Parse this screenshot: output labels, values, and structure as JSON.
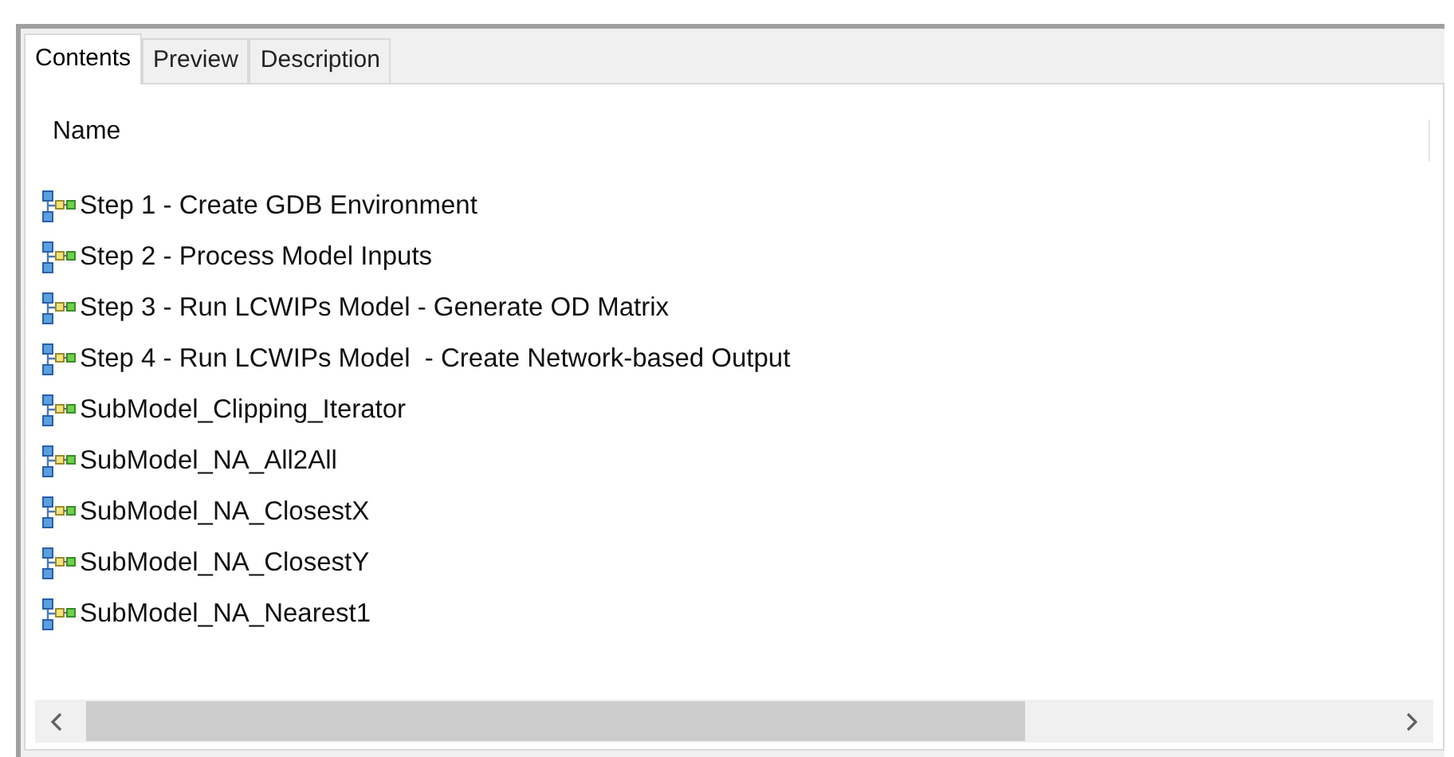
{
  "tabs": [
    {
      "label": "Contents",
      "selected": true
    },
    {
      "label": "Preview",
      "selected": false
    },
    {
      "label": "Description",
      "selected": false
    }
  ],
  "list": {
    "column_header": "Name",
    "items": [
      {
        "label": "Step 1 - Create GDB Environment"
      },
      {
        "label": "Step 2 - Process Model Inputs"
      },
      {
        "label": "Step 3 - Run LCWIPs Model - Generate OD Matrix"
      },
      {
        "label": "Step 4 - Run LCWIPs Model  - Create Network-based Output"
      },
      {
        "label": "SubModel_Clipping_Iterator"
      },
      {
        "label": "SubModel_NA_All2All"
      },
      {
        "label": "SubModel_NA_ClosestX"
      },
      {
        "label": "SubModel_NA_ClosestY"
      },
      {
        "label": "SubModel_NA_Nearest1"
      }
    ]
  }
}
